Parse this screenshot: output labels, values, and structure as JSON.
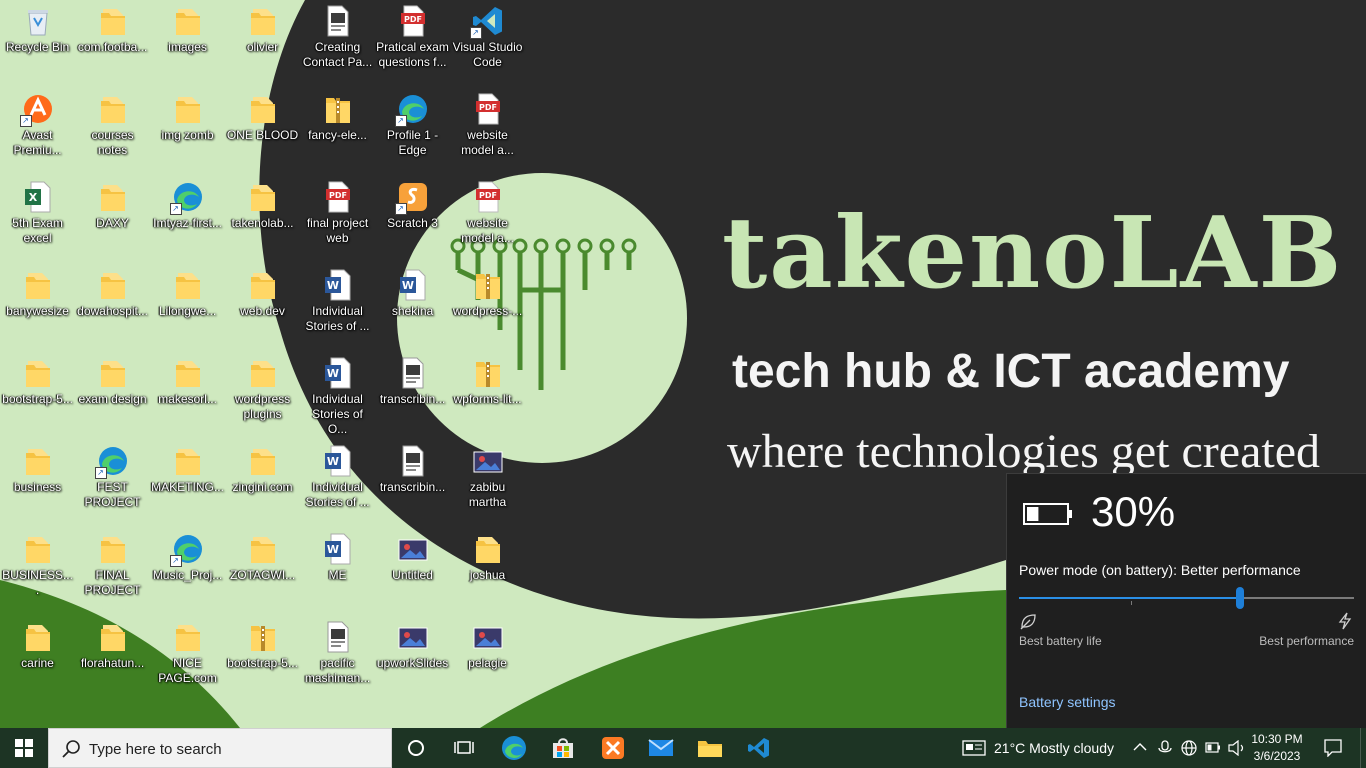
{
  "wallpaper": {
    "title": "takenoLAB",
    "subtitle": "tech hub & ICT academy",
    "tagline": "where technologies get created"
  },
  "desktop_icons": [
    {
      "label": "Recycle Bin",
      "icon": "recycle-bin-icon"
    },
    {
      "label": "com.footba...",
      "icon": "folder-icon"
    },
    {
      "label": "images",
      "icon": "folder-icon"
    },
    {
      "label": "olivier",
      "icon": "folder-icon"
    },
    {
      "label": "Creating Contact Pa...",
      "icon": "file-icon"
    },
    {
      "label": "Pratical exam questions f...",
      "icon": "pdf-icon"
    },
    {
      "label": "Visual Studio Code",
      "icon": "vscode-icon"
    },
    {
      "label": "Avast Premiu...",
      "icon": "avast-icon"
    },
    {
      "label": "courses notes",
      "icon": "folder-icon"
    },
    {
      "label": "img zomb",
      "icon": "folder-icon"
    },
    {
      "label": "ONE BLOOD",
      "icon": "folder-icon"
    },
    {
      "label": "fancy-ele...",
      "icon": "zip-folder-icon"
    },
    {
      "label": "Profile 1 - Edge",
      "icon": "edge-icon"
    },
    {
      "label": "website model a...",
      "icon": "pdf-icon"
    },
    {
      "label": "5th Exam excel",
      "icon": "excel-icon"
    },
    {
      "label": "DAXY",
      "icon": "folder-icon"
    },
    {
      "label": "Imtyaz-first...",
      "icon": "edge-icon"
    },
    {
      "label": "takenolab...",
      "icon": "folder-icon"
    },
    {
      "label": "final project web",
      "icon": "pdf-icon"
    },
    {
      "label": "Scratch 3",
      "icon": "scratch-icon"
    },
    {
      "label": "website model a...",
      "icon": "pdf-icon"
    },
    {
      "label": "banywesize",
      "icon": "folder-icon"
    },
    {
      "label": "dowahospit...",
      "icon": "folder-icon"
    },
    {
      "label": "Lilongwe...",
      "icon": "folder-icon"
    },
    {
      "label": "web.dev",
      "icon": "folder-icon"
    },
    {
      "label": "Individual Stories of ...",
      "icon": "word-icon"
    },
    {
      "label": "shekina",
      "icon": "word-icon"
    },
    {
      "label": "wordpress-...",
      "icon": "zip-folder-icon"
    },
    {
      "label": "bootstrap-5...",
      "icon": "folder-icon"
    },
    {
      "label": "exam design",
      "icon": "folder-icon"
    },
    {
      "label": "makesorl...",
      "icon": "folder-icon"
    },
    {
      "label": "wordpress plugins",
      "icon": "folder-icon"
    },
    {
      "label": "Individual Stories of O...",
      "icon": "word-icon"
    },
    {
      "label": "transcribin...",
      "icon": "file-icon"
    },
    {
      "label": "wpforms-lit...",
      "icon": "zip-folder-icon"
    },
    {
      "label": "business",
      "icon": "folder-icon"
    },
    {
      "label": "FEST PROJECT",
      "icon": "edge-icon"
    },
    {
      "label": "MAKETING...",
      "icon": "folder-icon"
    },
    {
      "label": "zingini.com",
      "icon": "folder-icon"
    },
    {
      "label": "Individual Stories of ...",
      "icon": "word-icon"
    },
    {
      "label": "transcribin...",
      "icon": "file-icon"
    },
    {
      "label": "zabibu martha",
      "icon": "image-icon"
    },
    {
      "label": "BUSINESS....",
      "icon": "folder-icon"
    },
    {
      "label": "FINAL PROJECT",
      "icon": "folder-icon"
    },
    {
      "label": "Music_Proj...",
      "icon": "edge-icon"
    },
    {
      "label": "ZOTAGWI...",
      "icon": "folder-icon"
    },
    {
      "label": "ME",
      "icon": "word-icon"
    },
    {
      "label": "Untitled",
      "icon": "image-icon"
    },
    {
      "label": "joshua",
      "icon": "folder-icon"
    },
    {
      "label": "carine",
      "icon": "folder-icon"
    },
    {
      "label": "florahatun...",
      "icon": "folder-icon"
    },
    {
      "label": "NICE PAGE.com",
      "icon": "folder-icon"
    },
    {
      "label": "bootstrap-5...",
      "icon": "zip-folder-icon"
    },
    {
      "label": "pacific mashiman...",
      "icon": "file-icon"
    },
    {
      "label": "upworkSlides",
      "icon": "image-icon"
    },
    {
      "label": "pelagie",
      "icon": "image-icon"
    }
  ],
  "battery_flyout": {
    "percent": "30%",
    "percent_value": 30,
    "power_mode_label": "Power mode (on battery): Better performance",
    "slider_value": 0.66,
    "left_label": "Best battery life",
    "right_label": "Best performance",
    "settings_link": "Battery settings",
    "accent_color": "#2a8fe6"
  },
  "taskbar": {
    "search_placeholder": "Type here to search",
    "pinned": [
      "cortana-icon",
      "task-view-icon",
      "edge-icon",
      "store-icon",
      "xampp-icon",
      "mail-icon",
      "file-explorer-icon",
      "vscode-icon"
    ],
    "weather": "21°C  Mostly cloudy",
    "time": "10:30 PM",
    "date": "3/6/2023"
  }
}
